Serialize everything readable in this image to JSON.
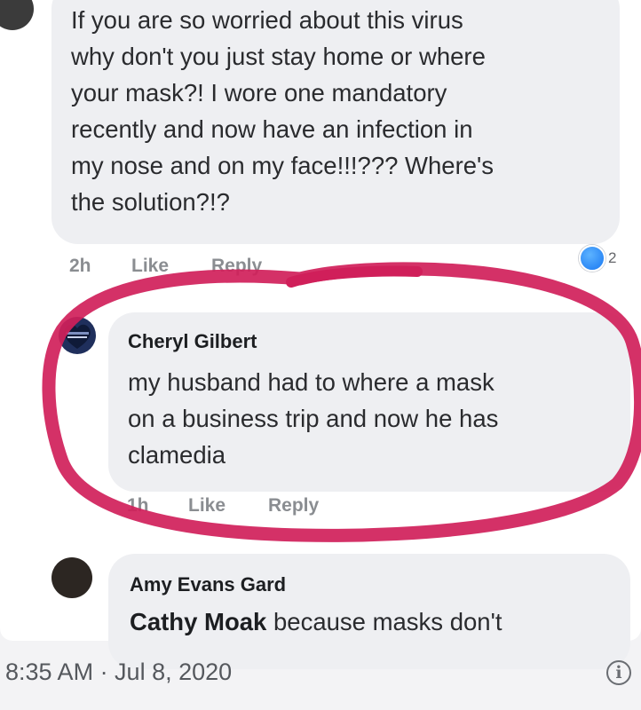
{
  "comments": [
    {
      "author": "",
      "text": "If you are so worried about this virus why don't you just stay home or where your mask?! I wore one mandatory recently and now have an infection in my nose and on my face!!!??? Where's the solution?!?",
      "lines": [
        "If you are so worried about this virus",
        "why don't you just stay home or where",
        "your mask?! I wore one mandatory",
        "recently and now have an infection in",
        "my nose and on my face!!!??? Where's",
        "the solution?!?"
      ],
      "time": "2h",
      "like_label": "Like",
      "reply_label": "Reply",
      "reaction_count": "2"
    },
    {
      "author": "Cheryl Gilbert",
      "lines": [
        "my husband had to where a mask",
        "on a business trip and now he has",
        "clamedia"
      ],
      "time": "1h",
      "like_label": "Like",
      "reply_label": "Reply"
    },
    {
      "author": "Amy Evans Gard",
      "mention": "Cathy Moak",
      "text_after_mention": " because masks don't"
    }
  ],
  "footer": {
    "timestamp": "8:35 AM · Jul 8, 2020"
  },
  "colors": {
    "highlight_circle": "#d01f5a",
    "bubble": "#eeeff2",
    "meta_text": "#8a8d91",
    "reaction_badge": "#1877f2"
  },
  "icons": [
    "info-icon",
    "reaction-badge-icon"
  ]
}
